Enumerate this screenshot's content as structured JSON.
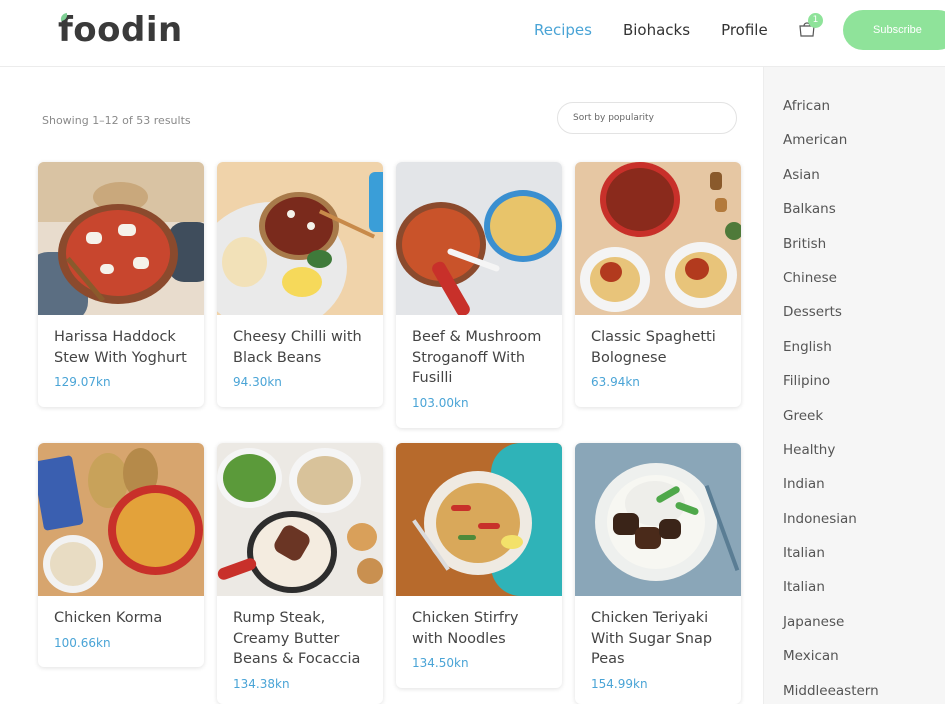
{
  "brand": {
    "logo_text": "foodin",
    "accent": "#4aa4d6",
    "button_color": "#8fe39a"
  },
  "nav": {
    "items": [
      "Recipes",
      "Biohacks",
      "Profile"
    ],
    "active": "Recipes"
  },
  "cart": {
    "count": "1",
    "icon": "shopping-bag-icon"
  },
  "subscribe_label": "Subscribe",
  "toolbar": {
    "results_text": "Showing 1–12 of 53 results",
    "sort_value": "Sort by popularity"
  },
  "products": [
    {
      "title": "Harissa Haddock Stew With Yoghurt",
      "price": "129.07kn"
    },
    {
      "title": "Cheesy Chilli with Black Beans",
      "price": "94.30kn"
    },
    {
      "title": "Beef & Mushroom Stroganoff With Fusilli",
      "price": "103.00kn"
    },
    {
      "title": "Classic Spaghetti Bolognese",
      "price": "63.94kn"
    },
    {
      "title": "Chicken Korma",
      "price": "100.66kn"
    },
    {
      "title": "Rump Steak, Creamy Butter Beans & Focaccia",
      "price": "134.38kn"
    },
    {
      "title": "Chicken Stirfry with Noodles",
      "price": "134.50kn"
    },
    {
      "title": "Chicken Teriyaki With Sugar Snap Peas",
      "price": "154.99kn"
    }
  ],
  "sidebar": {
    "categories": [
      "African",
      "American",
      "Asian",
      "Balkans",
      "British",
      "Chinese",
      "Desserts",
      "English",
      "Filipino",
      "Greek",
      "Healthy",
      "Indian",
      "Indonesian",
      "Italian",
      "Italian",
      "Japanese",
      "Mexican",
      "Middleeastern"
    ]
  }
}
